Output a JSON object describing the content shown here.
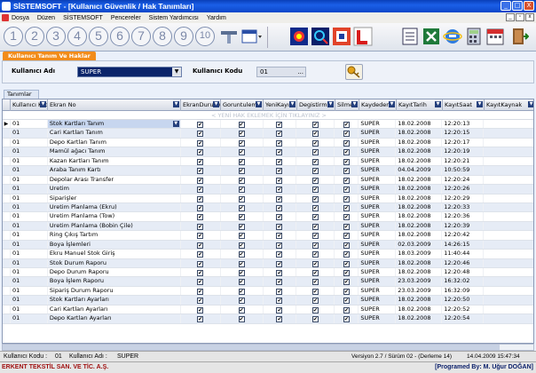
{
  "window": {
    "title": "SİSTEMSOFT  - [Kullanıcı Güvenlik / Hak Tanımları]",
    "controls": [
      "_",
      "□",
      "X"
    ]
  },
  "menu": {
    "items": [
      "Dosya",
      "Düzen",
      "SİSTEMSOFT",
      "Pencereler",
      "Sistem Yardımcısı",
      "Yardım"
    ],
    "mdi_controls": [
      "_",
      "▫",
      "x"
    ]
  },
  "toolbar": {
    "number_buttons": [
      "1",
      "2",
      "3",
      "4",
      "5",
      "6",
      "7",
      "8",
      "9",
      "10"
    ]
  },
  "form": {
    "tab_title": "Kullanıcı Tanım Ve Haklar",
    "user_label": "Kullanıcı Adı",
    "user_value": "SUPER",
    "code_label": "Kullanıcı Kodu",
    "code_value": "01",
    "code_ellipsis": "...",
    "subtab": "Tanımlar"
  },
  "grid": {
    "columns": [
      "Kullanıcı Kodu",
      "Ekran No",
      "EkranDurumu",
      "Goruntuleme",
      "YeniKayıt",
      "Degistirme",
      "Silme",
      "Kaydeden",
      "KayıtTarih",
      "KayıtSaat",
      "KayıtKaynak"
    ],
    "new_row_hint": "< YENİ HAK EKLEMEK İÇİN TIKLAYINIZ >",
    "check_mark": "✔",
    "current_row_marker": "▶",
    "rows": [
      {
        "kod": "01",
        "ekran": "Stok Kartları Tanım",
        "kaydeden": "SUPER",
        "tarih": "18.02.2008",
        "saat": "12:20:13"
      },
      {
        "kod": "01",
        "ekran": "Cari Kartları Tanım",
        "kaydeden": "SUPER",
        "tarih": "18.02.2008",
        "saat": "12:20:15"
      },
      {
        "kod": "01",
        "ekran": "Depo Kartları Tanım",
        "kaydeden": "SUPER",
        "tarih": "18.02.2008",
        "saat": "12:20:17"
      },
      {
        "kod": "01",
        "ekran": "Mamül ağacı Tanım",
        "kaydeden": "SUPER",
        "tarih": "18.02.2008",
        "saat": "12:20:19"
      },
      {
        "kod": "01",
        "ekran": "Kazan Kartları Tanım",
        "kaydeden": "SUPER",
        "tarih": "18.02.2008",
        "saat": "12:20:21"
      },
      {
        "kod": "01",
        "ekran": "Araba Tanım Kartı",
        "kaydeden": "SUPER",
        "tarih": "04.04.2009",
        "saat": "10:50:59"
      },
      {
        "kod": "01",
        "ekran": "Depolar Arası Transfer",
        "kaydeden": "SUPER",
        "tarih": "18.02.2008",
        "saat": "12:20:24"
      },
      {
        "kod": "01",
        "ekran": "Uretim",
        "kaydeden": "SUPER",
        "tarih": "18.02.2008",
        "saat": "12:20:26"
      },
      {
        "kod": "01",
        "ekran": "Siparişler",
        "kaydeden": "SUPER",
        "tarih": "18.02.2008",
        "saat": "12:20:29"
      },
      {
        "kod": "01",
        "ekran": "Uretim Planlama (Ekru)",
        "kaydeden": "SUPER",
        "tarih": "18.02.2008",
        "saat": "12:20:33"
      },
      {
        "kod": "01",
        "ekran": "Uretim Planlama (Tow)",
        "kaydeden": "SUPER",
        "tarih": "18.02.2008",
        "saat": "12:20:36"
      },
      {
        "kod": "01",
        "ekran": "Uretim Planlama (Bobin Çile)",
        "kaydeden": "SUPER",
        "tarih": "18.02.2008",
        "saat": "12:20:39"
      },
      {
        "kod": "01",
        "ekran": "Ring Çıkış Tartım",
        "kaydeden": "SUPER",
        "tarih": "18.02.2008",
        "saat": "12:20:42"
      },
      {
        "kod": "01",
        "ekran": "Boya İşlemleri",
        "kaydeden": "SUPER",
        "tarih": "02.03.2009",
        "saat": "14:26:15"
      },
      {
        "kod": "01",
        "ekran": "Ekru Manuel Stok Giriş",
        "kaydeden": "SUPER",
        "tarih": "18.03.2009",
        "saat": "11:40:44"
      },
      {
        "kod": "01",
        "ekran": "Stok Durum Raporu",
        "kaydeden": "SUPER",
        "tarih": "18.02.2008",
        "saat": "12:20:46"
      },
      {
        "kod": "01",
        "ekran": "Depo Durum Raporu",
        "kaydeden": "SUPER",
        "tarih": "18.02.2008",
        "saat": "12:20:48"
      },
      {
        "kod": "01",
        "ekran": "Boya İşlem Raporu",
        "kaydeden": "SUPER",
        "tarih": "23.03.2009",
        "saat": "16:32:02"
      },
      {
        "kod": "01",
        "ekran": "Sipariş Durum Raporu",
        "kaydeden": "SUPER",
        "tarih": "23.03.2009",
        "saat": "16:32:09"
      },
      {
        "kod": "01",
        "ekran": "Stok Kartları Ayarları",
        "kaydeden": "SUPER",
        "tarih": "18.02.2008",
        "saat": "12:20:50"
      },
      {
        "kod": "01",
        "ekran": "Cari Kartları Ayarları",
        "kaydeden": "SUPER",
        "tarih": "18.02.2008",
        "saat": "12:20:52"
      },
      {
        "kod": "01",
        "ekran": "Depo Kartları Ayarları",
        "kaydeden": "SUPER",
        "tarih": "18.02.2008",
        "saat": "12:20:54"
      }
    ]
  },
  "status": {
    "user_code_label": "Kullanıcı Kodu :",
    "user_code": "01",
    "user_name_label": "Kullanıcı Adı :",
    "user_name": "SUPER",
    "version": "Versiyon 2.7 / Sürüm 02 - (Derleme 14)",
    "datetime": "14.04.2009 15:47:34",
    "company": "ERKENT TEKSTİL SAN. VE TİC. A.Ş.",
    "author": "[Programed By: M. Uğur DOĞAN]"
  },
  "colors": {
    "title_bar": "#1b5fe8",
    "tab_orange": "#f28c1a",
    "selected_combo": "#0a246a",
    "company_text": "#a01010"
  }
}
